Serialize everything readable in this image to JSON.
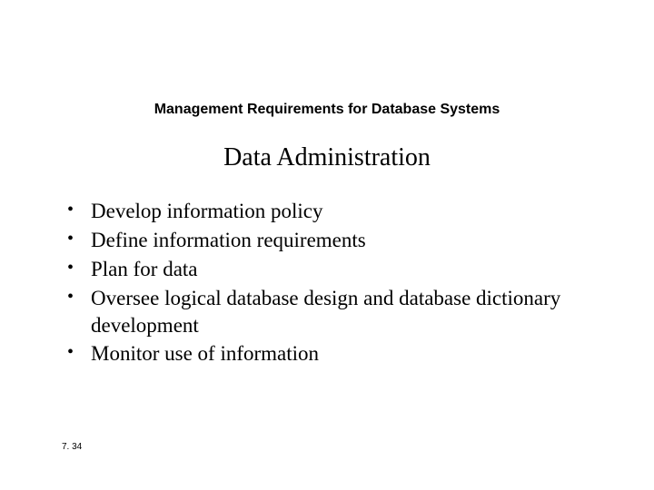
{
  "section_header": "Management Requirements for Database Systems",
  "title": "Data Administration",
  "bullets": {
    "item0": "Develop information policy",
    "item1": "Define information requirements",
    "item2": "Plan for data",
    "item3": "Oversee logical database design and database dictionary development",
    "item4": "Monitor use of information"
  },
  "page_number": "7. 34"
}
